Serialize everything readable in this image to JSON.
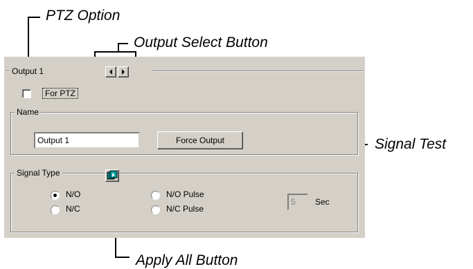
{
  "callouts": {
    "ptz_option": "PTZ Option",
    "output_select_button": "Output Select Button",
    "signal_test": "Signal Test",
    "apply_all_button": "Apply All Button"
  },
  "dialog": {
    "output_group_label": "Output 1",
    "ptz_checkbox": {
      "label": "For PTZ",
      "checked": false
    },
    "name_group": {
      "legend": "Name",
      "name_value": "Output 1",
      "force_output_label": "Force Output"
    },
    "signal_type_group": {
      "legend": "Signal Type",
      "options": [
        {
          "label": "N/O",
          "selected": true
        },
        {
          "label": "N/C",
          "selected": false
        },
        {
          "label": "N/O Pulse",
          "selected": false
        },
        {
          "label": "N/C Pulse",
          "selected": false
        }
      ],
      "pulse_seconds": "5",
      "seconds_unit": "Sec"
    }
  },
  "icons": {
    "prev": "arrow-left-icon",
    "next": "arrow-right-icon",
    "apply_all": "apply-all-icon"
  }
}
